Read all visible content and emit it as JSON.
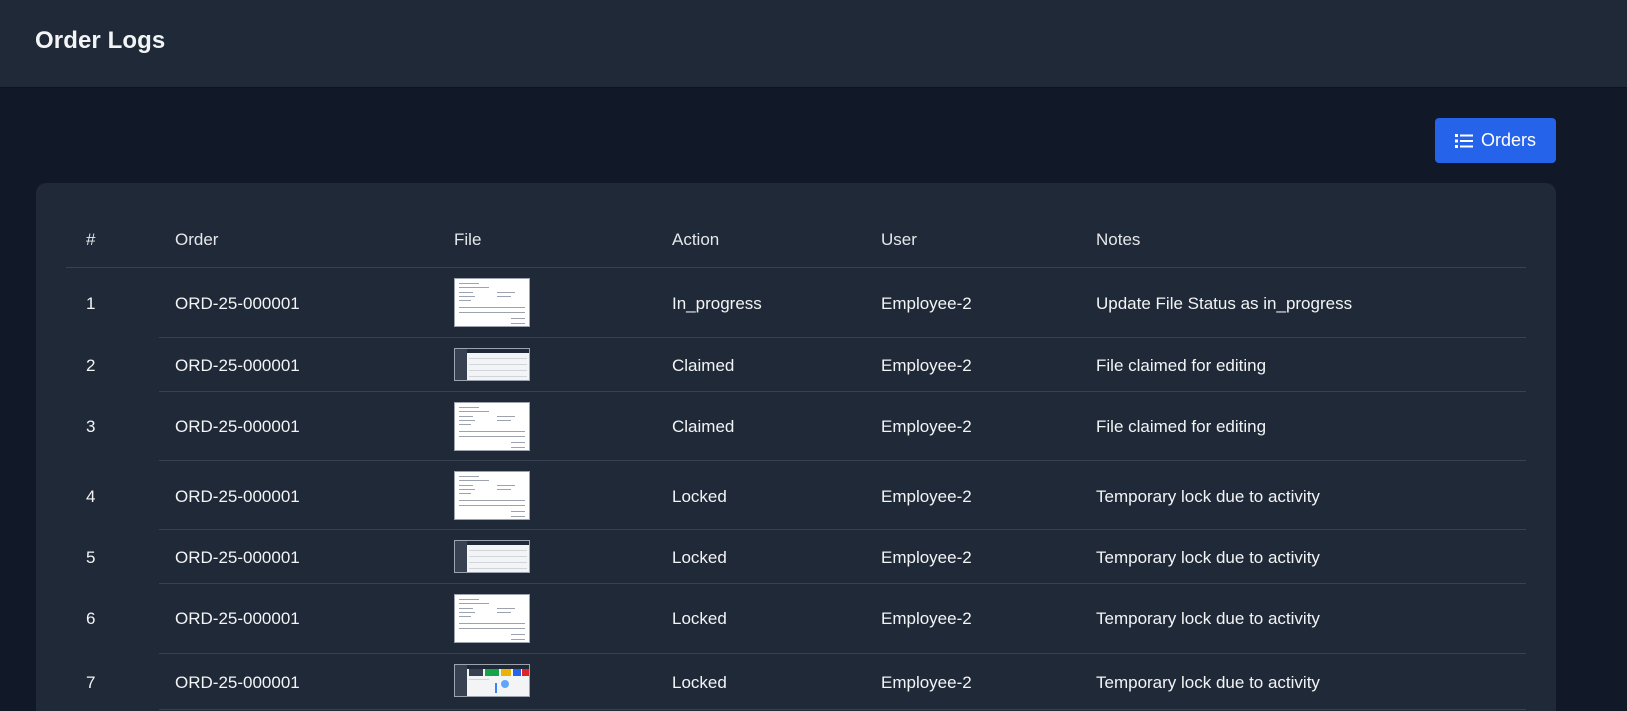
{
  "header": {
    "title": "Order Logs"
  },
  "toolbar": {
    "orders_label": "Orders",
    "orders_icon": "list-icon",
    "accent": "#2563eb"
  },
  "table": {
    "columns": [
      "#",
      "Order",
      "File",
      "Action",
      "User",
      "Notes"
    ],
    "rows": [
      {
        "num": "1",
        "order": "ORD-25-000001",
        "file_thumb": "document-preview",
        "action": "In_progress",
        "user": "Employee-2",
        "notes": "Update File Status as in_progress"
      },
      {
        "num": "2",
        "order": "ORD-25-000001",
        "file_thumb": "dashboard-preview",
        "action": "Claimed",
        "user": "Employee-2",
        "notes": "File claimed for editing"
      },
      {
        "num": "3",
        "order": "ORD-25-000001",
        "file_thumb": "document-preview",
        "action": "Claimed",
        "user": "Employee-2",
        "notes": "File claimed for editing"
      },
      {
        "num": "4",
        "order": "ORD-25-000001",
        "file_thumb": "document-preview",
        "action": "Locked",
        "user": "Employee-2",
        "notes": "Temporary lock due to activity"
      },
      {
        "num": "5",
        "order": "ORD-25-000001",
        "file_thumb": "dashboard-preview",
        "action": "Locked",
        "user": "Employee-2",
        "notes": "Temporary lock due to activity"
      },
      {
        "num": "6",
        "order": "ORD-25-000001",
        "file_thumb": "document-preview",
        "action": "Locked",
        "user": "Employee-2",
        "notes": "Temporary lock due to activity"
      },
      {
        "num": "7",
        "order": "ORD-25-000001",
        "file_thumb": "dashboard-tiles-preview",
        "action": "Locked",
        "user": "Employee-2",
        "notes": "Temporary lock due to activity"
      }
    ]
  }
}
